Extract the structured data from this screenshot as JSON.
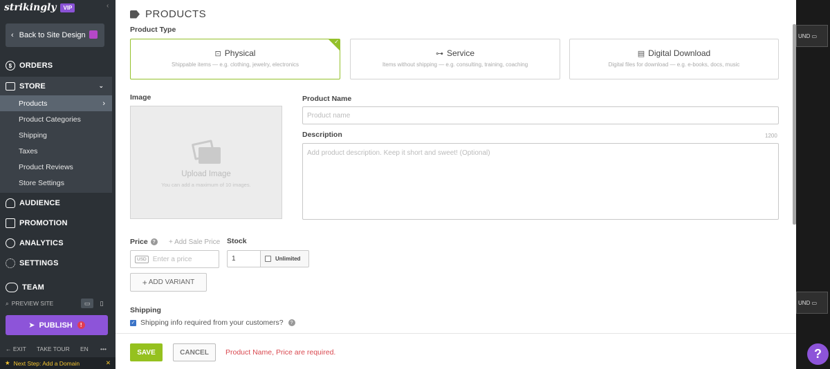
{
  "sidebar": {
    "logo": "strikingly",
    "vip": "VIP",
    "back": "Back to Site Design",
    "orders": "ORDERS",
    "store": "STORE",
    "store_items": [
      "Products",
      "Product Categories",
      "Shipping",
      "Taxes",
      "Product Reviews",
      "Store Settings"
    ],
    "audience": "AUDIENCE",
    "promotion": "PROMOTION",
    "analytics": "ANALYTICS",
    "settings": "SETTINGS",
    "team": "TEAM",
    "preview": "PREVIEW SITE",
    "publish": "PUBLISH",
    "publish_badge": "!",
    "exit": "EXIT",
    "tour": "TAKE TOUR",
    "lang": "EN",
    "more": "•••",
    "next_step": "Next Step: Add a Domain"
  },
  "panel": {
    "title": "PRODUCTS",
    "product_type_label": "Product Type",
    "types": [
      {
        "name": "Physical",
        "desc": "Shippable items — e.g. clothing, jewelry, electronics",
        "selected": true
      },
      {
        "name": "Service",
        "desc": "Items without shipping — e.g. consulting, training, coaching",
        "selected": false
      },
      {
        "name": "Digital Download",
        "desc": "Digital files for download — e.g. e-books, docs, music",
        "selected": false
      }
    ],
    "image_label": "Image",
    "upload_title": "Upload Image",
    "upload_sub": "You can add a maximum of 10 images.",
    "name_label": "Product Name",
    "name_placeholder": "Product name",
    "desc_label": "Description",
    "desc_counter": "1200",
    "desc_placeholder": "Add product description. Keep it short and sweet! (Optional)",
    "price_label": "Price",
    "sale_price": "+ Add Sale Price",
    "stock_label": "Stock",
    "currency": "USD",
    "price_placeholder": "Enter a price",
    "stock_value": "1",
    "unlimited": "Unlimited",
    "add_variant": "ADD VARIANT",
    "shipping_label": "Shipping",
    "shipping_check": "Shipping info required from your customers?",
    "save": "SAVE",
    "cancel": "CANCEL",
    "error": "Product Name, Price are required."
  },
  "background": {
    "tab1": "UND",
    "tab2": "UND"
  },
  "help": "?",
  "colors": {
    "accent_green": "#95c11f",
    "brand_purple": "#8d54d9",
    "error_red": "#d9484f",
    "sidebar_bg": "#2c3136"
  }
}
